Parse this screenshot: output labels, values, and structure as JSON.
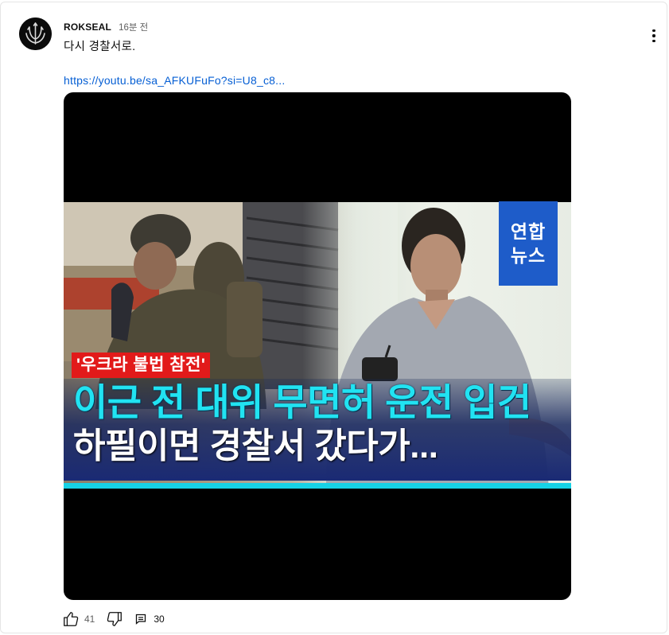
{
  "comment": {
    "author": "ROKSEAL",
    "time": "16분 전",
    "text": "다시 경찰서로.",
    "link": "https://youtu.be/sa_AFKUFuFo?si=U8_c8..."
  },
  "thumbnail": {
    "badge_line1": "연합",
    "badge_line2": "뉴스",
    "tag": "'우크라 불법 참전'",
    "headline1": "이근 전 대위 무면허 운전 입건",
    "headline2": "하필이면 경찰서 갔다가...",
    "colors": {
      "badge": "#1e5cc9",
      "tag": "#e21a1a",
      "headline1": "#21e3f2",
      "accent_bar": "#16d2e6"
    }
  },
  "actions": {
    "like_count": "41",
    "reply_count": "30",
    "icons": [
      "thumbs-up-icon",
      "thumbs-down-icon",
      "reply-icon",
      "more-vert-icon"
    ]
  }
}
